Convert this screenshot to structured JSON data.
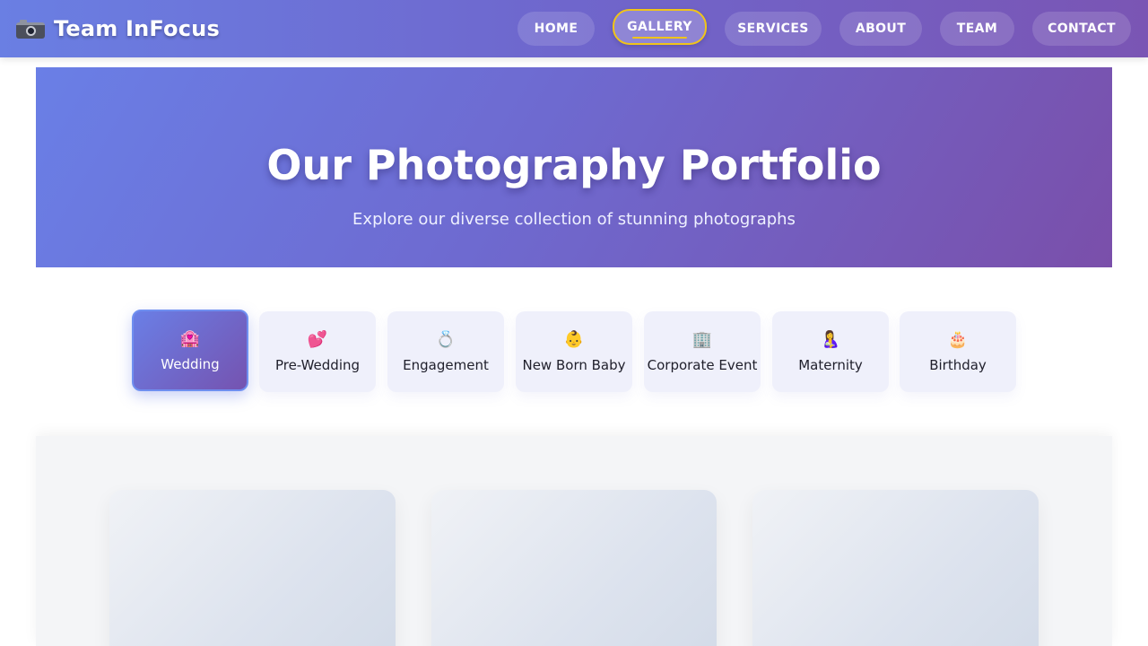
{
  "brand": {
    "name": "Team InFocus",
    "icon": "camera-icon"
  },
  "nav": {
    "items": [
      {
        "label": "HOME"
      },
      {
        "label": "GALLERY",
        "active": true
      },
      {
        "label": "SERVICES"
      },
      {
        "label": "ABOUT"
      },
      {
        "label": "TEAM"
      },
      {
        "label": "CONTACT"
      }
    ]
  },
  "hero": {
    "title": "Our Photography Portfolio",
    "subtitle": "Explore our diverse collection of stunning photographs"
  },
  "categories": [
    {
      "label": "Wedding",
      "icon": "🏩",
      "icon_name": "wedding-chapel-icon",
      "active": true
    },
    {
      "label": "Pre-Wedding",
      "icon": "💕",
      "icon_name": "hearts-icon"
    },
    {
      "label": "Engagement",
      "icon": "💍",
      "icon_name": "ring-icon"
    },
    {
      "label": "New Born Baby",
      "icon": "👶",
      "icon_name": "baby-icon"
    },
    {
      "label": "Corporate Event",
      "icon": "🏢",
      "icon_name": "office-building-icon"
    },
    {
      "label": "Maternity",
      "icon": "🤱",
      "icon_name": "mother-baby-icon"
    },
    {
      "label": "Birthday",
      "icon": "🎂",
      "icon_name": "birthday-cake-icon"
    }
  ],
  "colors": {
    "accent": "#f0c419",
    "gradient_start": "#6a7fe6",
    "gradient_end": "#7a4faa"
  }
}
